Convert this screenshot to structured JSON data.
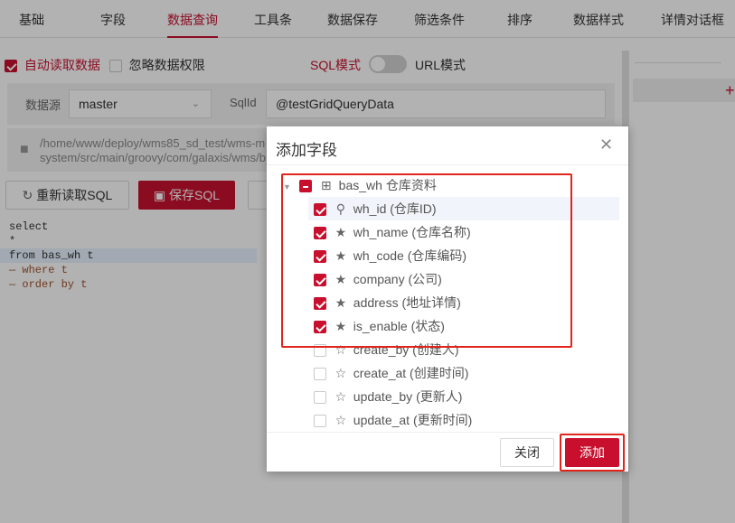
{
  "tabs": [
    "基础",
    "字段",
    "数据查询",
    "工具条",
    "数据保存",
    "筛选条件",
    "排序",
    "数据样式",
    "详情对话框"
  ],
  "options": {
    "auto_read_label": "自动读取数据",
    "ignore_perm_label": "忽略数据权限",
    "sql_mode_label": "SQL模式",
    "url_mode_label": "URL模式"
  },
  "form": {
    "datasource_label": "数据源",
    "datasource_value": "master",
    "sqlid_label": "SqlId",
    "sqlid_value": "@testGridQueryData"
  },
  "path": {
    "line1": "/home/www/deploy/wms85_sd_test/wms-m",
    "line2": "system/src/main/groovy/com/galaxis/wms/b"
  },
  "buttons": {
    "reload_sql": "重新读取SQL",
    "save_sql": "保存SQL"
  },
  "code": {
    "l1": "select",
    "l2": "*",
    "l3": "from bas_wh t",
    "l4": "— where t",
    "l5": "— order by t"
  },
  "dialog": {
    "title": "添加字段",
    "root": "bas_wh 仓库资料",
    "items": [
      {
        "label": "wh_id (仓库ID)",
        "icon": "key-icon",
        "checked": true
      },
      {
        "label": "wh_name (仓库名称)",
        "icon": "star-solid-icon",
        "checked": true
      },
      {
        "label": "wh_code (仓库编码)",
        "icon": "star-solid-icon",
        "checked": true
      },
      {
        "label": "company (公司)",
        "icon": "star-solid-icon",
        "checked": true
      },
      {
        "label": "address (地址详情)",
        "icon": "star-solid-icon",
        "checked": true
      },
      {
        "label": "is_enable (状态)",
        "icon": "star-solid-icon",
        "checked": true
      },
      {
        "label": "create_by (创建人)",
        "icon": "star-outline-icon",
        "checked": false
      },
      {
        "label": "create_at (创建时间)",
        "icon": "star-outline-icon",
        "checked": false
      },
      {
        "label": "update_by (更新人)",
        "icon": "star-outline-icon",
        "checked": false
      },
      {
        "label": "update_at (更新时间)",
        "icon": "star-outline-icon",
        "checked": false
      }
    ],
    "close_label": "关闭",
    "add_label": "添加"
  },
  "colors": {
    "accent": "#c8102e",
    "highlight_box": "#e1251b"
  }
}
